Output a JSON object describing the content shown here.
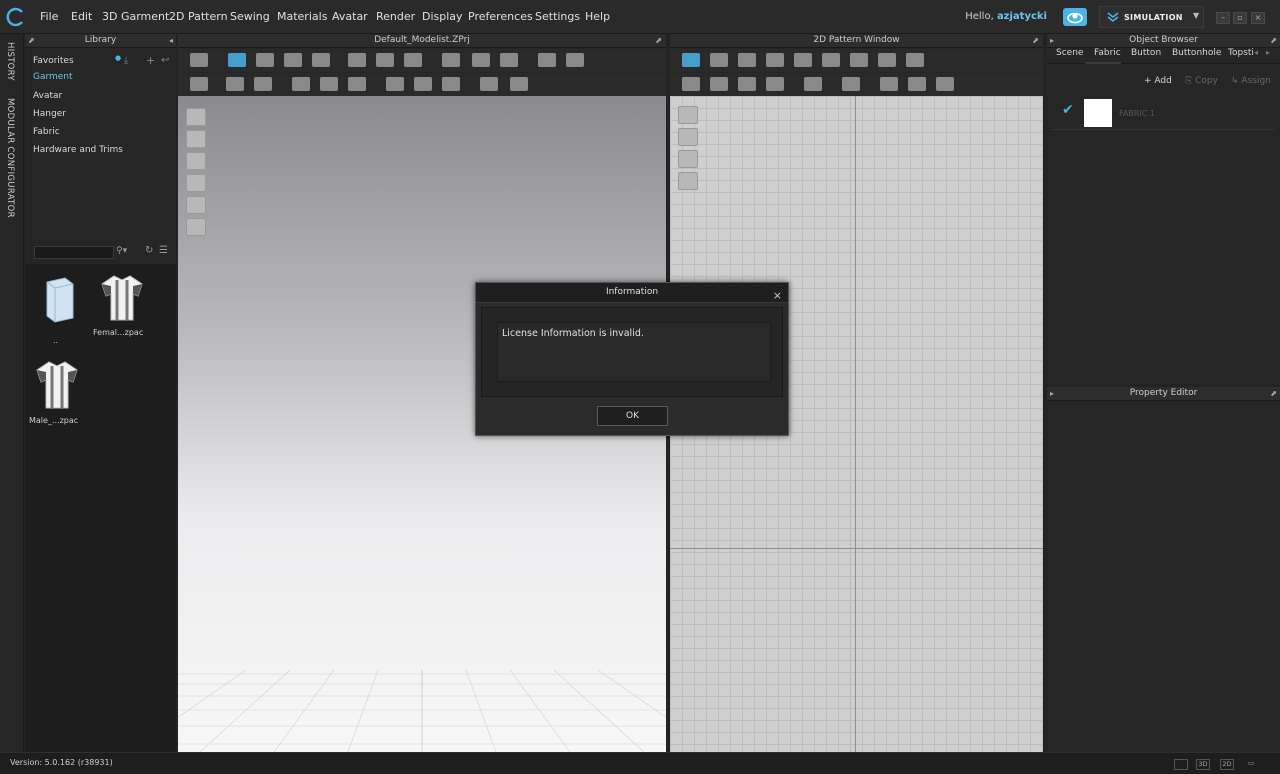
{
  "menubar": {
    "items": [
      "File",
      "Edit",
      "3D Garment",
      "2D Pattern",
      "Sewing",
      "Materials",
      "Avatar",
      "Render",
      "Display",
      "Preferences",
      "Settings",
      "Help"
    ],
    "greeting": "Hello,",
    "username": "azjatycki",
    "mode_label": "SIMULATION"
  },
  "vertical_tabs": [
    "HISTORY",
    "MODULAR CONFIGURATOR"
  ],
  "library": {
    "title": "Library",
    "items": [
      "Favorites",
      "Garment",
      "Avatar",
      "Hanger",
      "Fabric",
      "Hardware and Trims"
    ],
    "active_item": "Garment",
    "thumbnails": [
      "..",
      "Femal...zpac",
      "Male_...zpac"
    ]
  },
  "window3d": {
    "title": "Default_Modelist.ZPrj"
  },
  "window2d": {
    "title": "2D Pattern Window"
  },
  "object_browser": {
    "title": "Object Browser",
    "tabs": [
      "Scene",
      "Fabric",
      "Button",
      "Buttonhole",
      "Topsti"
    ],
    "active_tab": "Fabric",
    "actions": [
      "Add",
      "Copy",
      "Assign"
    ],
    "fabric_item": "FABRIC 1"
  },
  "property_editor": {
    "title": "Property Editor"
  },
  "statusbar": {
    "version": "Version: 5.0.162 (r38931)",
    "view_buttons": [
      "3D",
      "2D"
    ]
  },
  "dialog": {
    "title": "Information",
    "message": "License Information is invalid.",
    "ok_label": "OK",
    "close_glyph": "×"
  },
  "colors": {
    "accent": "#4ab4e8",
    "bg": "#232323",
    "panel": "#262626"
  }
}
